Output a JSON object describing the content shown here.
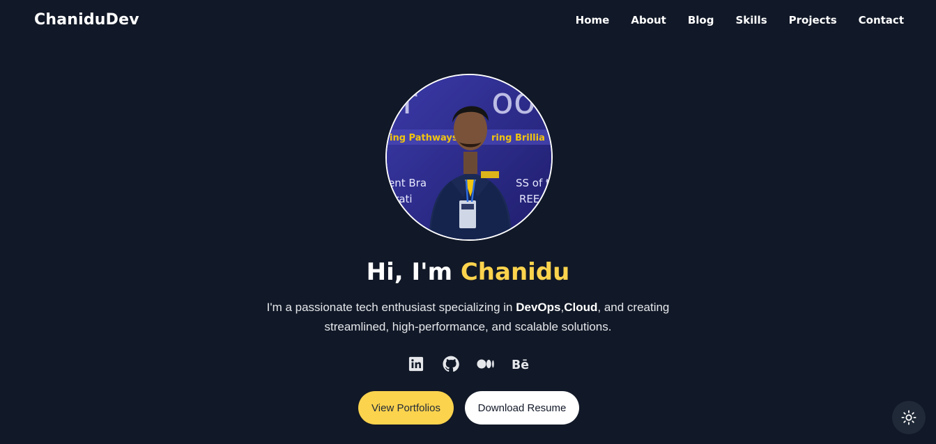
{
  "nav": {
    "brand": "ChaniduDev",
    "items": [
      "Home",
      "About",
      "Blog",
      "Skills",
      "Projects",
      "Contact"
    ]
  },
  "hero": {
    "avatar_alt": "Profile photo of Chanidu",
    "greeting": "Hi, I'm",
    "name": "Chanidu",
    "intro_before": "I'm a passionate tech enthusiast specializing in ",
    "intro_strong_1": "DevOps",
    "intro_sep": ",",
    "intro_strong_2": "Cloud",
    "intro_after": ", and creating streamlined, high-performance, and scalable solutions.",
    "socials": [
      {
        "name": "linkedin-icon",
        "label": "LinkedIn"
      },
      {
        "name": "github-icon",
        "label": "GitHub"
      },
      {
        "name": "medium-icon",
        "label": "Medium"
      },
      {
        "name": "behance-icon",
        "label": "Behance"
      }
    ],
    "primary_button": "View Portfolios",
    "secondary_button": "Download Resume"
  },
  "theme_toggle": {
    "icon": "sun-icon"
  },
  "colors": {
    "background": "#111827",
    "accent": "#fcd34d",
    "text": "#ffffff"
  }
}
